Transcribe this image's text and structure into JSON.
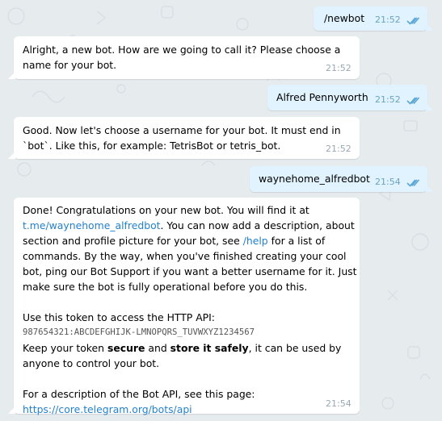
{
  "theme": {
    "background": "#e6ebee",
    "incoming_bubble": "#ffffff",
    "outgoing_bubble": "#e1f3fe",
    "link": "#2481cc",
    "tick": "#5aa6d6"
  },
  "messages": [
    {
      "dir": "out",
      "text": "/newbot",
      "time": "21:52",
      "status_icon": "double-check-icon"
    },
    {
      "dir": "in",
      "line1": "Alright, a new bot. How are we going to call it? Please choose a",
      "line2": "name for your bot.",
      "time": "21:52"
    },
    {
      "dir": "out",
      "text": "Alfred Pennyworth",
      "time": "21:52",
      "status_icon": "double-check-icon"
    },
    {
      "dir": "in",
      "line1": "Good. Now let's choose a username for your bot. It must end in",
      "line2": "`bot`. Like this, for example: TetrisBot or tetris_bot.",
      "time": "21:52"
    },
    {
      "dir": "out",
      "text": "waynehome_alfredbot",
      "time": "21:54",
      "status_icon": "double-check-icon"
    },
    {
      "dir": "in",
      "time": "21:54",
      "p1_line1": "Done! Congratulations on your new bot. You will find it at",
      "bot_link": "t.me/waynehome_alfredbot",
      "p1_after_link": ". You can now add a description, about",
      "p1_line3": "section and profile picture for your bot, see",
      "help_link": "/help",
      "p1_after_help": "for a list of",
      "p1_line4": "commands. By the way, when you've finished creating your cool",
      "p1_line5": "bot, ping our Bot Support if you want a better username for it. Just",
      "p1_line6": "make sure the bot is fully operational before you do this.",
      "token_intro": "Use this token to access the HTTP API:",
      "token": "987654321:ABCDEFGHIJK-LMNOPQRS_TUVWXYZ1234567",
      "keep_pre": "Keep your token",
      "keep_bold1": "secure",
      "keep_and": "and",
      "keep_bold2": "store it safely",
      "keep_post": ", it can be used by",
      "keep_line2": "anyone to control your bot.",
      "api_intro": "For a description of the Bot API, see this page:",
      "api_link": "https://core.telegram.org/bots/api"
    }
  ]
}
